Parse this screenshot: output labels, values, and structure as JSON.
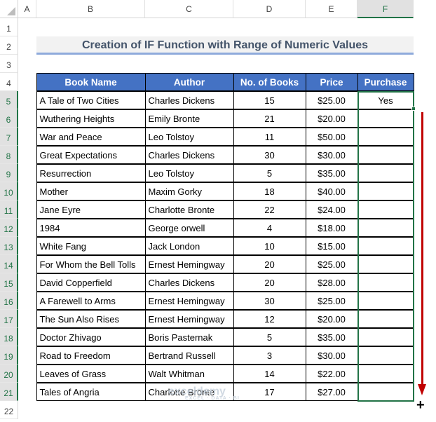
{
  "columns": [
    "A",
    "B",
    "C",
    "D",
    "E",
    "F"
  ],
  "rows": [
    "1",
    "2",
    "3",
    "4",
    "5",
    "6",
    "7",
    "8",
    "9",
    "10",
    "11",
    "12",
    "13",
    "14",
    "15",
    "16",
    "17",
    "18",
    "19",
    "20",
    "21",
    "22"
  ],
  "title": "Creation of IF Function with Range of Numeric Values",
  "headers": [
    "Book Name",
    "Author",
    "No. of Books",
    "Price",
    "Purchase"
  ],
  "data": [
    [
      "A Tale of Two Cities",
      "Charles Dickens",
      "15",
      "$25.00",
      "Yes"
    ],
    [
      "Wuthering Heights",
      "Emily Bronte",
      "21",
      "$20.00",
      ""
    ],
    [
      "War and Peace",
      "Leo Tolstoy",
      "11",
      "$50.00",
      ""
    ],
    [
      "Great Expectations",
      "Charles Dickens",
      "30",
      "$30.00",
      ""
    ],
    [
      "Resurrection",
      "Leo Tolstoy",
      "5",
      "$35.00",
      ""
    ],
    [
      "Mother",
      "Maxim Gorky",
      "18",
      "$40.00",
      ""
    ],
    [
      "Jane Eyre",
      "Charlotte Bronte",
      "22",
      "$24.00",
      ""
    ],
    [
      "1984",
      "George orwell",
      "4",
      "$18.00",
      ""
    ],
    [
      "White Fang",
      "Jack London",
      "10",
      "$15.00",
      ""
    ],
    [
      "For Whom the Bell Tolls",
      "Ernest Hemingway",
      "20",
      "$25.00",
      ""
    ],
    [
      "David Copperfield",
      "Charles Dickens",
      "20",
      "$28.00",
      ""
    ],
    [
      "A Farewell to Arms",
      "Ernest Hemingway",
      "30",
      "$25.00",
      ""
    ],
    [
      "The Sun Also Rises",
      "Ernest Hemingway",
      "12",
      "$20.00",
      ""
    ],
    [
      "Doctor Zhivago",
      "Boris Pasternak",
      "5",
      "$35.00",
      ""
    ],
    [
      "Road to Freedom",
      "Bertrand Russell",
      "3",
      "$30.00",
      ""
    ],
    [
      "Leaves of Grass",
      "Walt Whitman",
      "14",
      "$22.00",
      ""
    ],
    [
      "Tales of Angria",
      "Charlotte Bronte",
      "17",
      "$27.00",
      ""
    ]
  ],
  "watermark": {
    "name": "exceldemy",
    "tagline": "EXCEL · DATA · BI"
  },
  "colors": {
    "header": "#4472c4",
    "selection": "#217346",
    "arrow": "#c00000"
  }
}
